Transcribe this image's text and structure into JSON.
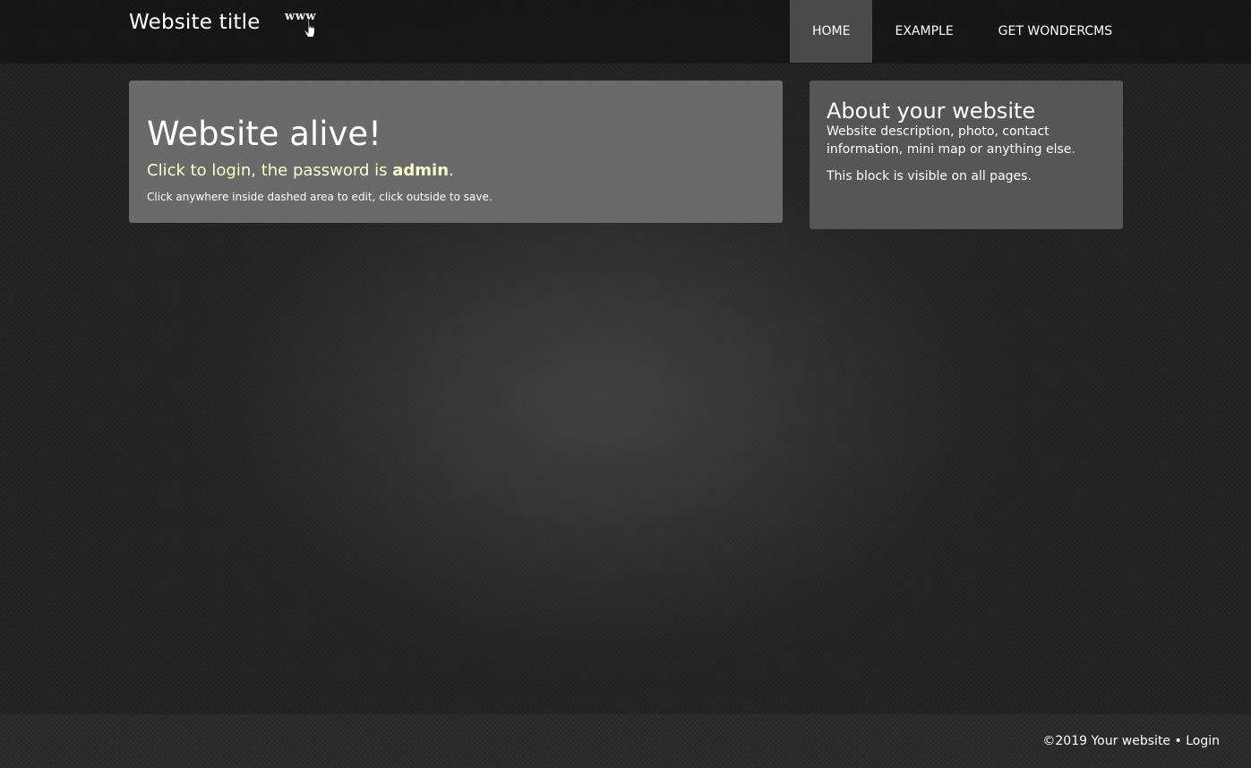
{
  "header": {
    "site_title": "Website title",
    "logo_text": "www",
    "logo_icon": "hand-pointer-icon",
    "nav": [
      {
        "label": "HOME",
        "active": true
      },
      {
        "label": "EXAMPLE",
        "active": false
      },
      {
        "label": "GET WONDERCMS",
        "active": false
      }
    ]
  },
  "main": {
    "heading": "Website alive!",
    "login_prefix": "Click to login, the password is ",
    "login_password": "admin",
    "login_suffix": ".",
    "edit_hint": "Click anywhere inside dashed area to edit, click outside to save."
  },
  "sidebar": {
    "heading": "About your website",
    "description": "Website description, photo, contact information, mini map or anything else.",
    "note": "This block is visible on all pages."
  },
  "footer": {
    "copyright": "©2019 Your website",
    "separator": " • ",
    "login_label": "Login"
  },
  "colors": {
    "background": "#232323",
    "main_card": "#6a6a6a",
    "side_card": "#565656",
    "nav_active": "#4a4a4a",
    "login_text": "#ffffcc"
  }
}
